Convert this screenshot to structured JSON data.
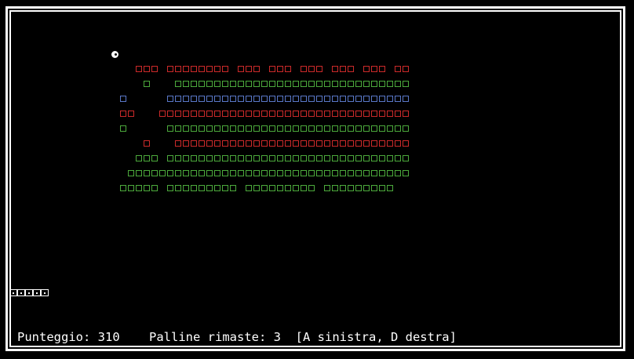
{
  "status": {
    "score_label": "Punteggio:",
    "score": "310",
    "balls_label": "Palline rimaste:",
    "balls": "3",
    "controls_hint": "[A sinistra, D destra]"
  },
  "paddle": {
    "segments": 5
  },
  "colors": {
    "red": "#cc2a2a",
    "green": "#4caa3c",
    "blue": "#5a78c8",
    "white": "#ffffff"
  },
  "bricks": {
    "rows": [
      {
        "color": "red",
        "pattern": "...ooo.oooooooo.ooo.ooo.ooo.ooo.ooo.oo"
      },
      {
        "color": "green",
        "pattern": "....o...oooooooooooooooooooooooooooooo"
      },
      {
        "color": "blue",
        "pattern": ".o.....ooooooooooooooooooooooooooooooo"
      },
      {
        "color": "red",
        "pattern": ".oo...oooooooooooooooooooooooooooooooo"
      },
      {
        "color": "green",
        "pattern": ".o.....ooooooooooooooooooooooooooooooo"
      },
      {
        "color": "red",
        "pattern": "....o...oooooooooooooooooooooooooooooo"
      },
      {
        "color": "green",
        "pattern": "...ooo.ooooooooooooooooooooooooooooooo"
      },
      {
        "color": "green",
        "pattern": "..oooooooooooooooooooooooooooooooooooo"
      },
      {
        "color": "green",
        "pattern": ".ooooo.ooooooooo.ooooooooo.ooooooooo."
      }
    ]
  }
}
